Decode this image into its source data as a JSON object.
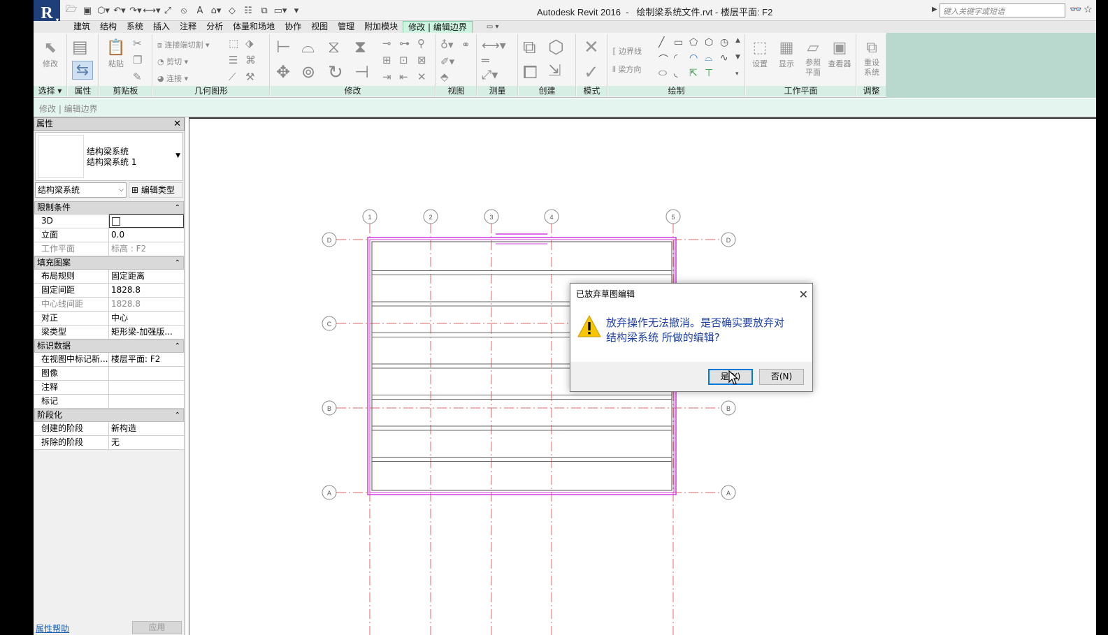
{
  "app": {
    "logo_letter": "R",
    "window_title": "Autodesk Revit 2016  -   绘制梁系统文件.rvt - 楼层平面: F2",
    "search_placeholder": "键入关键字或短语"
  },
  "quick_access": [
    "open-icon",
    "save-icon",
    "sync-icon",
    "undo-icon",
    "redo-icon",
    "measure-icon",
    "dimension-icon",
    "tag-icon",
    "text-icon",
    "3d-view-icon",
    "section-icon",
    "thin-lines-icon",
    "close-windows-icon",
    "switch-windows-icon",
    "customize-icon"
  ],
  "tabs": [
    "建筑",
    "结构",
    "系统",
    "插入",
    "注释",
    "分析",
    "体量和场地",
    "协作",
    "视图",
    "管理",
    "附加模块",
    "修改 | 编辑边界"
  ],
  "active_tab_index": 11,
  "ribbon": {
    "groups": {
      "select": "选择",
      "properties": "属性",
      "clipboard": "剪贴板",
      "geometry": "几何图形",
      "modify": "修改",
      "view": "视图",
      "measure": "测量",
      "create": "创建",
      "mode": "模式",
      "draw": "绘制",
      "workplane": "工作平面",
      "adjust": "调整"
    },
    "buttons": {
      "modify": "修改",
      "paste": "粘贴",
      "join_cut": "连接端切割",
      "cut": "剪切",
      "join": "连接",
      "boundary_line": "边界线",
      "beam_direction": "梁方向",
      "set": "设置",
      "show": "显示",
      "ref_plane": "参照\n平面",
      "viewer": "查看器",
      "reset_system": "重设\n系统"
    }
  },
  "options_bar": {
    "label": "修改 | 编辑边界"
  },
  "properties": {
    "title": "属性",
    "type_family": "结构梁系统",
    "type_name": "结构梁系统 1",
    "selector": "结构梁系统",
    "edit_type": "编辑类型",
    "sections": [
      {
        "name": "限制条件",
        "rows": [
          {
            "key": "3D",
            "value": "",
            "checkbox": true
          },
          {
            "key": "立面",
            "value": "0.0"
          },
          {
            "key": "工作平面",
            "value": "标高 : F2",
            "dim": true
          }
        ]
      },
      {
        "name": "填充图案",
        "rows": [
          {
            "key": "布局规则",
            "value": "固定距离"
          },
          {
            "key": "固定间距",
            "value": "1828.8"
          },
          {
            "key": "中心线间距",
            "value": "1828.8",
            "dim": true
          },
          {
            "key": "对正",
            "value": "中心"
          },
          {
            "key": "梁类型",
            "value": "矩形梁-加强版..."
          }
        ]
      },
      {
        "name": "标识数据",
        "rows": [
          {
            "key": "在视图中标记新...",
            "value": "楼层平面: F2"
          },
          {
            "key": "图像",
            "value": ""
          },
          {
            "key": "注释",
            "value": ""
          },
          {
            "key": "标记",
            "value": ""
          }
        ]
      },
      {
        "name": "阶段化",
        "rows": [
          {
            "key": "创建的阶段",
            "value": "新构造"
          },
          {
            "key": "拆除的阶段",
            "value": "无"
          }
        ]
      }
    ],
    "help_link": "属性帮助",
    "apply": "应用"
  },
  "grid": {
    "vertical_labels": [
      "1",
      "2",
      "3",
      "4",
      "5"
    ],
    "horizontal_labels": [
      "D",
      "C",
      "B",
      "A"
    ],
    "beam_count": 8
  },
  "dialog": {
    "title": "已放弃草图编辑",
    "message_line1": "放弃操作无法撤消。是否确实要放弃对",
    "message_line2": "结构梁系统 所做的编辑?",
    "yes": "是(Y)",
    "no": "否(N)"
  },
  "colors": {
    "accent_tab": "#cdf3e1",
    "sketch_magenta": "#d23be0",
    "grid_red": "#e06666",
    "dialog_text": "#1d3fa6",
    "revit_blue": "#1f3f7a"
  }
}
